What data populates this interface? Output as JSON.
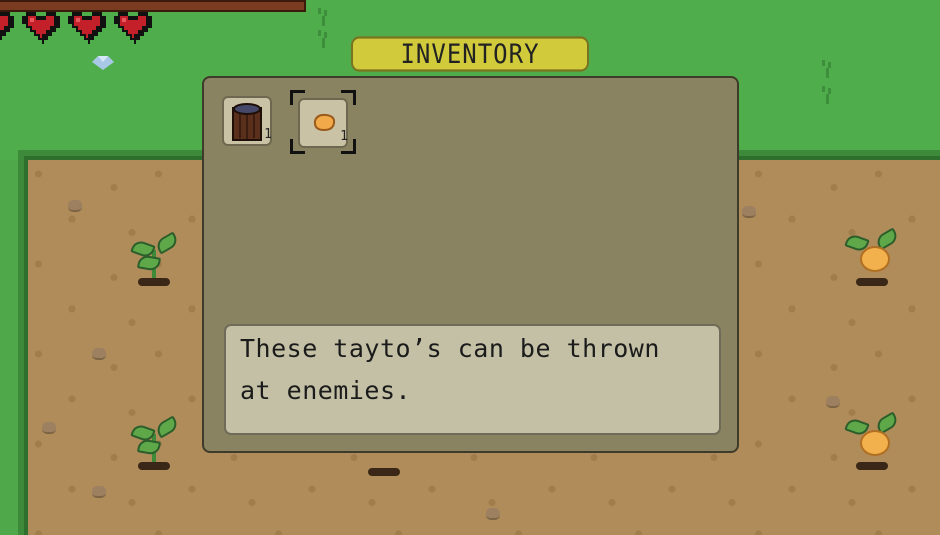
{
  "hud": {
    "hearts": [
      {
        "icon": "heart-icon",
        "state": "partial"
      },
      {
        "icon": "heart-icon",
        "state": "full"
      },
      {
        "icon": "heart-icon",
        "state": "full"
      },
      {
        "icon": "heart-icon",
        "state": "full"
      }
    ],
    "heart_color": "#c4202a"
  },
  "inventory": {
    "title": "INVENTORY",
    "slots": [
      {
        "icon": "wood-log-icon",
        "count": "1",
        "selected": false
      },
      {
        "icon": "tayto-potato-icon",
        "count": "1",
        "selected": true
      }
    ],
    "description": "These tayto’s can be thrown at enemies.",
    "colors": {
      "title_bg": "#d1cb3c",
      "panel_bg": "#8a8361",
      "desc_bg": "#c3c0a5"
    }
  }
}
